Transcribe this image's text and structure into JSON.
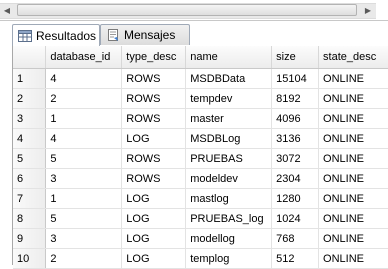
{
  "tabs": [
    {
      "label": "Resultados",
      "icon": "grid-results-icon"
    },
    {
      "label": "Mensajes",
      "icon": "messages-icon"
    }
  ],
  "columns": [
    "database_id",
    "type_desc",
    "name",
    "size",
    "state_desc"
  ],
  "rows": [
    {
      "num": "1",
      "database_id": "4",
      "type_desc": "ROWS",
      "name": "MSDBData",
      "size": "15104",
      "state_desc": "ONLINE"
    },
    {
      "num": "2",
      "database_id": "2",
      "type_desc": "ROWS",
      "name": "tempdev",
      "size": "8192",
      "state_desc": "ONLINE"
    },
    {
      "num": "3",
      "database_id": "1",
      "type_desc": "ROWS",
      "name": "master",
      "size": "4096",
      "state_desc": "ONLINE"
    },
    {
      "num": "4",
      "database_id": "4",
      "type_desc": "LOG",
      "name": "MSDBLog",
      "size": "3136",
      "state_desc": "ONLINE"
    },
    {
      "num": "5",
      "database_id": "5",
      "type_desc": "ROWS",
      "name": "PRUEBAS",
      "size": "3072",
      "state_desc": "ONLINE"
    },
    {
      "num": "6",
      "database_id": "3",
      "type_desc": "ROWS",
      "name": "modeldev",
      "size": "2304",
      "state_desc": "ONLINE"
    },
    {
      "num": "7",
      "database_id": "1",
      "type_desc": "LOG",
      "name": "mastlog",
      "size": "1280",
      "state_desc": "ONLINE"
    },
    {
      "num": "8",
      "database_id": "5",
      "type_desc": "LOG",
      "name": "PRUEBAS_log",
      "size": "1024",
      "state_desc": "ONLINE"
    },
    {
      "num": "9",
      "database_id": "3",
      "type_desc": "LOG",
      "name": "modellog",
      "size": "768",
      "state_desc": "ONLINE"
    },
    {
      "num": "10",
      "database_id": "2",
      "type_desc": "LOG",
      "name": "templog",
      "size": "512",
      "state_desc": "ONLINE"
    }
  ],
  "colors": {
    "header_bg": "#ececec",
    "grid_line": "#e3e3e3",
    "tab_border": "#9fa9b7"
  }
}
